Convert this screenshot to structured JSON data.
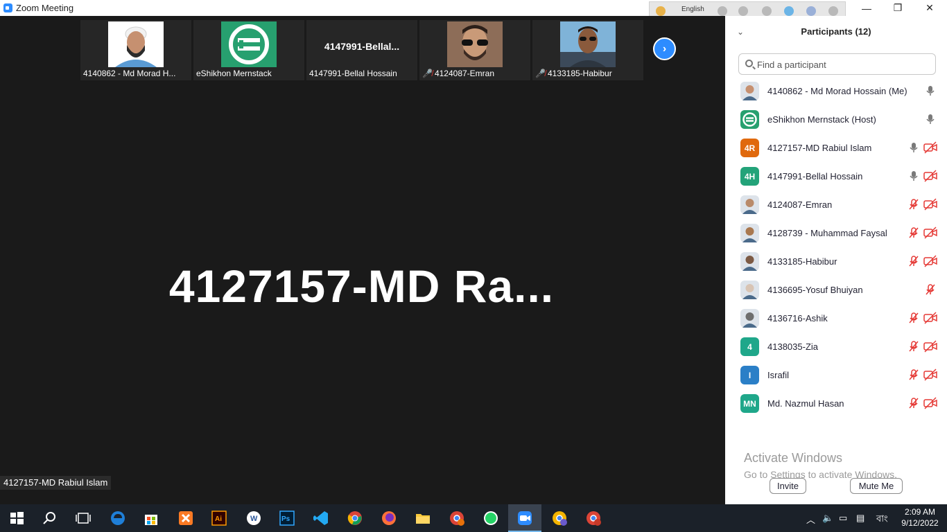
{
  "window": {
    "title": "Zoom Meeting",
    "language": "English",
    "controls": {
      "minimize": "—",
      "restore": "❐",
      "close": "✕"
    }
  },
  "main": {
    "thumbnails": [
      {
        "label": "4140862 - Md Morad H...",
        "muted": false
      },
      {
        "label": "eShikhon Mernstack",
        "muted": false
      },
      {
        "name_display": "4147991-Bellal...",
        "label": "4147991-Bellal Hossain",
        "muted": false
      },
      {
        "label": "4124087-Emran",
        "muted": true
      },
      {
        "label": "4133185-Habibur",
        "muted": true
      }
    ],
    "next_icon": "›",
    "active_speaker_display": "4127157-MD Ra...",
    "active_speaker_label": "4127157-MD Rabiul Islam"
  },
  "panel": {
    "collapse_icon": "⌄",
    "title": "Participants (12)",
    "search_placeholder": "Find a participant",
    "participants": [
      {
        "name": "4140862 - Md Morad Hossain (Me)",
        "avatar": "photo",
        "mic": "on",
        "video": "none"
      },
      {
        "name": "eShikhon Mernstack (Host)",
        "avatar": "logo",
        "mic": "on",
        "video": "none"
      },
      {
        "name": "4127157-MD Rabiul Islam",
        "initials": "4R",
        "color": "#e0690d",
        "mic": "on",
        "video": "off"
      },
      {
        "name": "4147991-Bellal Hossain",
        "initials": "4H",
        "color": "#23a379",
        "mic": "on",
        "video": "off"
      },
      {
        "name": "4124087-Emran",
        "avatar": "photo",
        "mic": "muted",
        "video": "off"
      },
      {
        "name": "4128739 - Muhammad Faysal",
        "avatar": "photo",
        "mic": "muted",
        "video": "off"
      },
      {
        "name": "4133185-Habibur",
        "avatar": "photo",
        "mic": "muted",
        "video": "off"
      },
      {
        "name": "4136695-Yosuf Bhuiyan",
        "avatar": "photo",
        "mic": "muted",
        "video": "none"
      },
      {
        "name": "4136716-Ashik",
        "avatar": "photo",
        "mic": "muted",
        "video": "off"
      },
      {
        "name": "4138035-Zia",
        "initials": "4",
        "color": "#1fa78a",
        "mic": "muted",
        "video": "off"
      },
      {
        "name": "Israfil",
        "initials": "I",
        "color": "#2b7fc7",
        "mic": "muted",
        "video": "off"
      },
      {
        "name": "Md. Nazmul Hasan",
        "initials": "MN",
        "color": "#1fa78a",
        "mic": "muted",
        "video": "off"
      }
    ],
    "watermark": {
      "line1": "Activate Windows",
      "line2": "Go to Settings to activate Windows."
    },
    "invite_label": "Invite",
    "mute_me_label": "Mute Me"
  },
  "taskbar": {
    "clock_time": "2:09 AM",
    "clock_date": "9/12/2022",
    "language_glyph": "বাং",
    "colors": {
      "accent": "#2d8cff",
      "muted_red": "#e53935"
    }
  }
}
